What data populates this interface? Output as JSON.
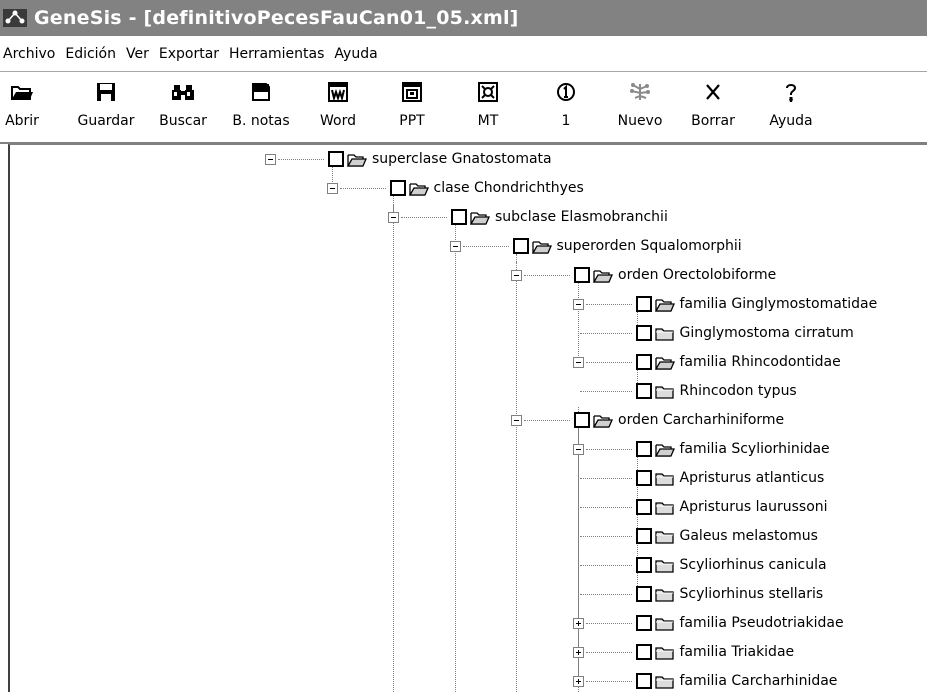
{
  "window": {
    "title": "GeneSis - [definitivoPecesFauCan01_05.xml]"
  },
  "menu": [
    "Archivo",
    "Edición",
    "Ver",
    "Exportar",
    "Herramientas",
    "Ayuda"
  ],
  "toolbar": [
    {
      "label": "Abrir",
      "icon": "open-folder-icon"
    },
    {
      "label": "Guardar",
      "icon": "save-disk-icon"
    },
    {
      "label": "Buscar",
      "icon": "binoculars-icon"
    },
    {
      "label": "B. notas",
      "icon": "notes-icon"
    },
    {
      "label": "Word",
      "icon": "word-icon"
    },
    {
      "label": "PPT",
      "icon": "ppt-icon"
    },
    {
      "label": "MT",
      "icon": "mt-icon"
    },
    {
      "label": "1",
      "icon": "circled-one-icon"
    },
    {
      "label": "Nuevo",
      "icon": "new-tree-icon",
      "disabled": true
    },
    {
      "label": "Borrar",
      "icon": "delete-x-icon"
    },
    {
      "label": "Ayuda",
      "icon": "help-icon"
    }
  ],
  "tree": [
    {
      "label": "superclase Gnatostomata",
      "depth": 0,
      "expander": "minus",
      "open": true
    },
    {
      "label": "clase Chondrichthyes",
      "depth": 1,
      "expander": "minus",
      "open": true
    },
    {
      "label": "subclase Elasmobranchii",
      "depth": 2,
      "expander": "minus",
      "open": true
    },
    {
      "label": "superorden Squalomorphii",
      "depth": 3,
      "expander": "minus",
      "open": true
    },
    {
      "label": "orden Orectolobiforme",
      "depth": 4,
      "expander": "minus",
      "open": true
    },
    {
      "label": "familia Ginglymostomatidae",
      "depth": 5,
      "expander": "minus",
      "open": true
    },
    {
      "label": "Ginglymostoma cirratum",
      "depth": 6,
      "expander": "none",
      "open": false
    },
    {
      "label": "familia Rhincodontidae",
      "depth": 5,
      "expander": "minus",
      "open": true
    },
    {
      "label": "Rhincodon typus",
      "depth": 6,
      "expander": "none",
      "open": false
    },
    {
      "label": "orden Carcharhiniforme",
      "depth": 4,
      "expander": "minus",
      "open": true
    },
    {
      "label": "familia Scyliorhinidae",
      "depth": 5,
      "expander": "minus",
      "open": true
    },
    {
      "label": "Apristurus atlanticus",
      "depth": 6,
      "expander": "none",
      "open": false
    },
    {
      "label": "Apristurus laurussoni",
      "depth": 6,
      "expander": "none",
      "open": false
    },
    {
      "label": "Galeus melastomus",
      "depth": 6,
      "expander": "none",
      "open": false
    },
    {
      "label": "Scyliorhinus canicula",
      "depth": 6,
      "expander": "none",
      "open": false
    },
    {
      "label": "Scyliorhinus stellaris",
      "depth": 6,
      "expander": "none",
      "open": false
    },
    {
      "label": "familia Pseudotriakidae",
      "depth": 5,
      "expander": "plus",
      "open": false
    },
    {
      "label": "familia Triakidae",
      "depth": 5,
      "expander": "plus",
      "open": false
    },
    {
      "label": "familia Carcharhinidae",
      "depth": 5,
      "expander": "plus",
      "open": false
    }
  ]
}
